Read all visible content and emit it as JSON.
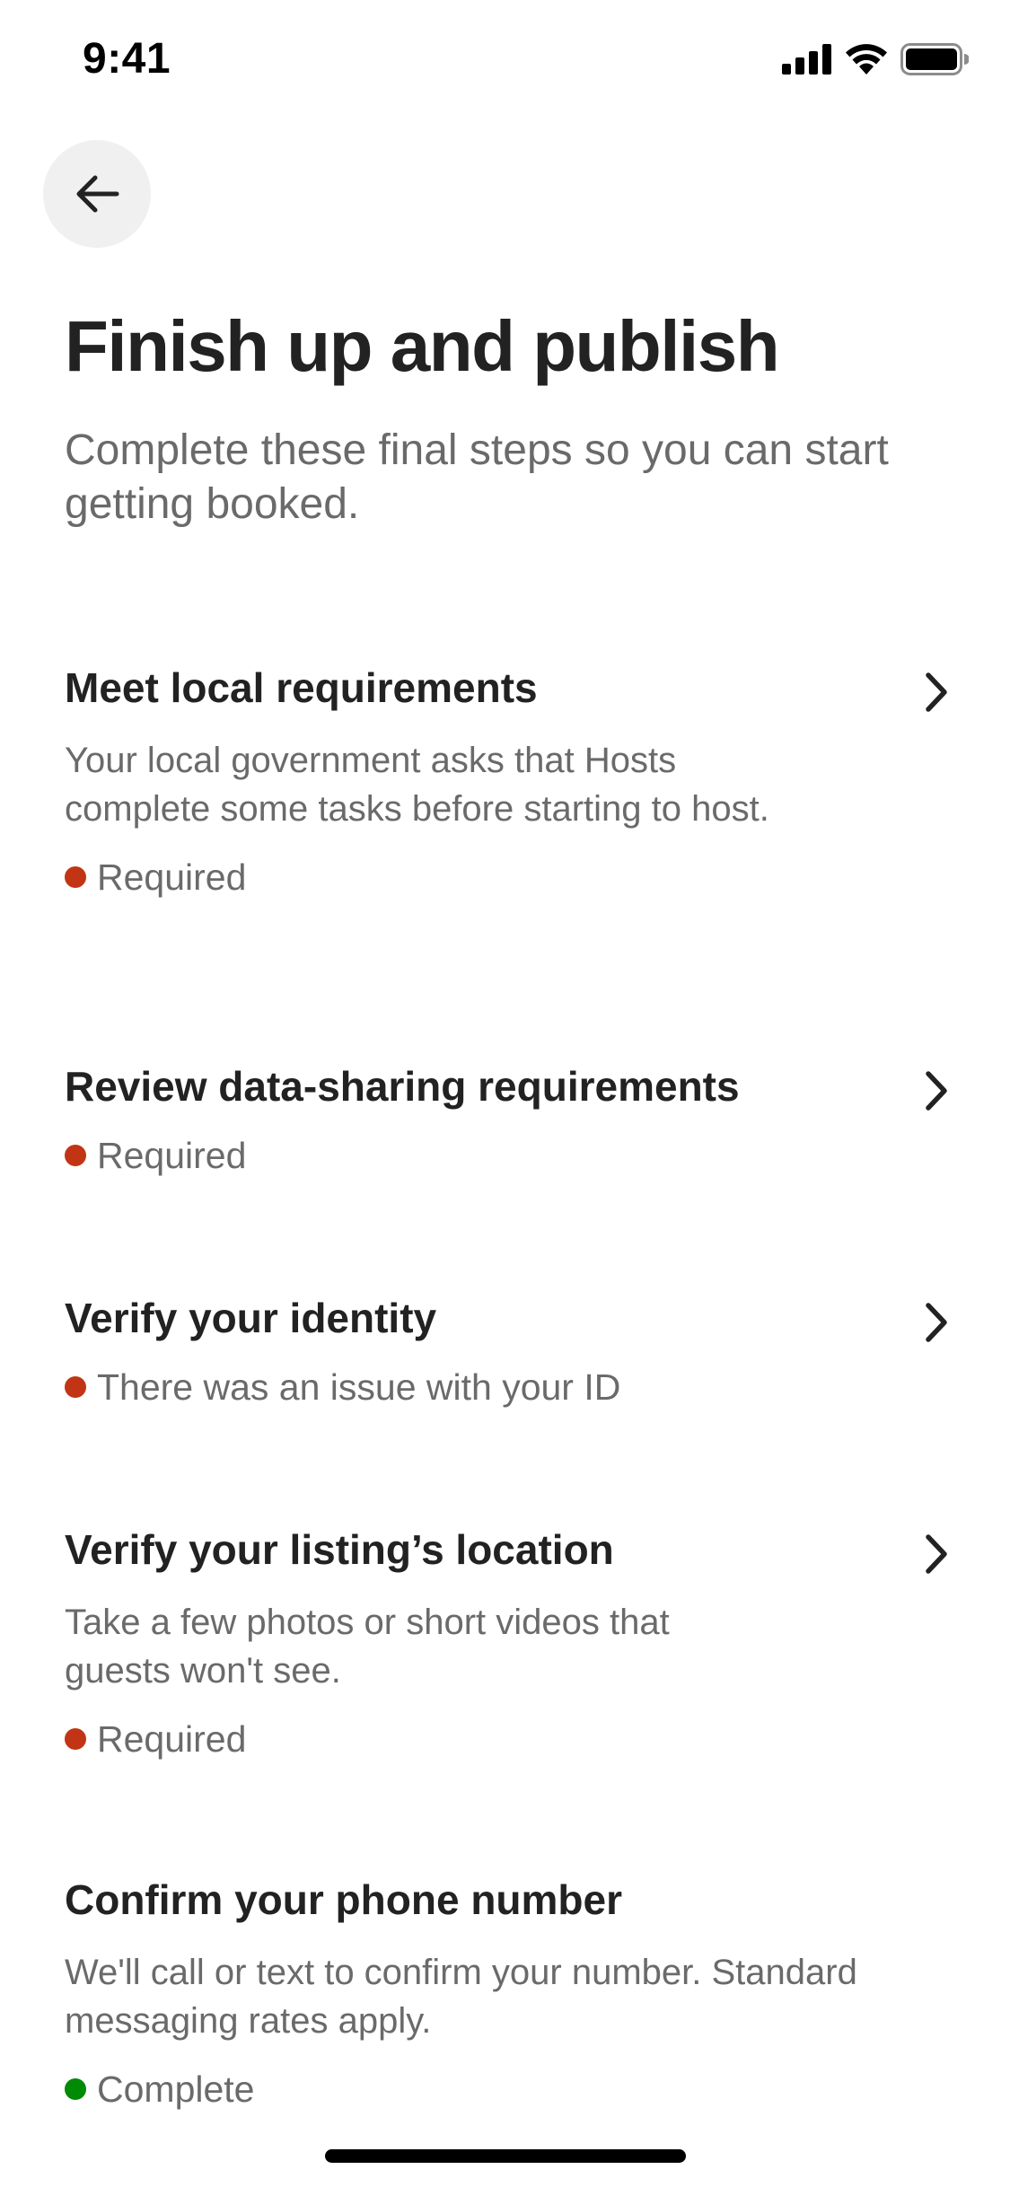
{
  "status_bar": {
    "time": "9:41"
  },
  "header": {
    "back_icon": "arrow-left-icon",
    "title": "Finish up and publish",
    "subtitle": "Complete these final steps so you can start getting booked."
  },
  "colors": {
    "required": "#c13515",
    "complete": "#008a05",
    "text_primary": "#222222",
    "text_secondary": "#6a6a6a"
  },
  "tasks": [
    {
      "title": "Meet local requirements",
      "description": "Your local government asks that Hosts complete some tasks before starting to host.",
      "status": "Required",
      "status_type": "required"
    },
    {
      "title": "Review data-sharing requirements",
      "description": "",
      "status": "Required",
      "status_type": "required"
    },
    {
      "title": "Verify your identity",
      "description": "",
      "status": "There was an issue with your ID",
      "status_type": "required"
    },
    {
      "title": "Verify your listing’s location",
      "description": "Take a few photos or short videos that guests won't see.",
      "status": "Required",
      "status_type": "required"
    },
    {
      "title": "Confirm your phone number",
      "description": "We'll call or text to confirm your number. Standard messaging rates apply.",
      "status": "Complete",
      "status_type": "complete"
    }
  ]
}
